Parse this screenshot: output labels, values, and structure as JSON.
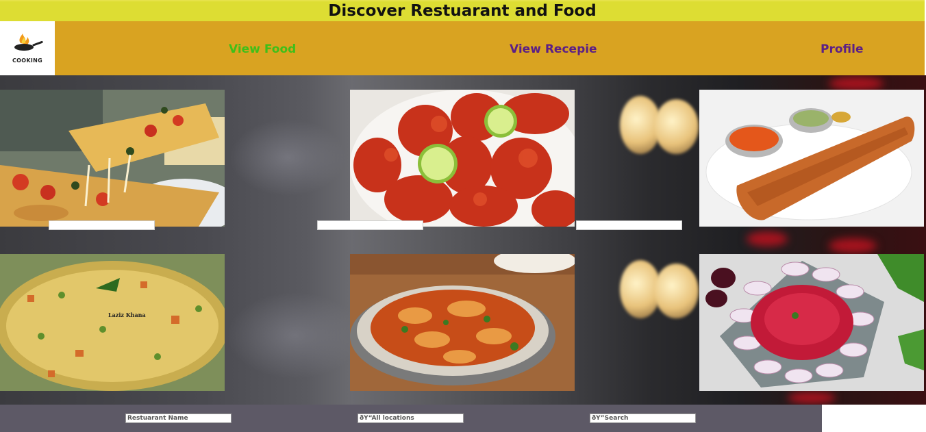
{
  "header": {
    "title": "Discover Restuarant and Food"
  },
  "nav": {
    "logo_text": "COOKING",
    "items": [
      {
        "label": "View Food"
      },
      {
        "label": "View Recepie"
      },
      {
        "label": "Profile"
      }
    ]
  },
  "gallery": {
    "tiles": [
      {
        "dish": "pizza"
      },
      {
        "dish": "fried-chicken"
      },
      {
        "dish": "dosa"
      },
      {
        "dish": "fried-rice",
        "watermark": "Laziz Khana"
      },
      {
        "dish": "fish-curry"
      },
      {
        "dish": "beetroot-rice"
      }
    ]
  },
  "footer": {
    "restaurant_placeholder": "Restuarant Name",
    "location_placeholder": "ðŸ“All locations",
    "search_placeholder": "ðŸ”Search"
  },
  "colors": {
    "title_bar": "#dddd33",
    "nav_bar": "#d9a321",
    "nav_active": "#3fbf19",
    "nav_link": "#5b1f86",
    "footer_bar": "#5d5966"
  }
}
